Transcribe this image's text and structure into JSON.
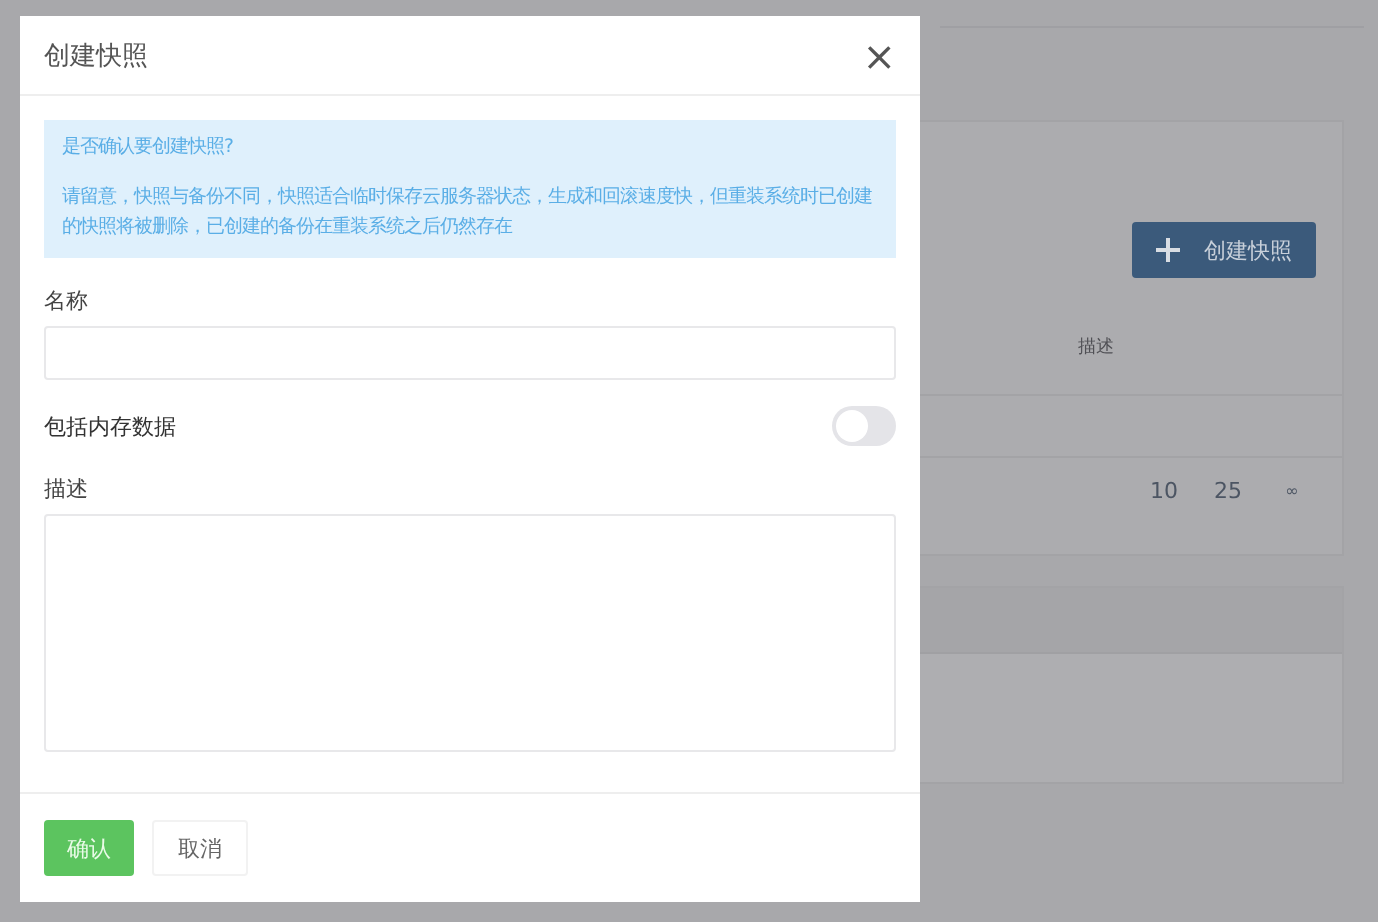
{
  "page": {
    "create_button": "创建快照",
    "column_header": "描述",
    "page_sizes": [
      "10",
      "25",
      "∞"
    ]
  },
  "dialog": {
    "title": "创建快照",
    "close": "×",
    "alert": {
      "question": "是否确认要创建快照?",
      "note": "请留意，快照与备份不同，快照适合临时保存云服务器状态，生成和回滚速度快，但重装系统时已创建的快照将被删除，已创建的备份在重装系统之后仍然存在"
    },
    "name_label": "名称",
    "memory_toggle": {
      "label": "包括内存数据",
      "on": false
    },
    "description_label": "描述",
    "buttons": [
      {
        "label": "确认",
        "kind": "primary"
      },
      {
        "label": "取消",
        "kind": "secondary"
      }
    ]
  }
}
